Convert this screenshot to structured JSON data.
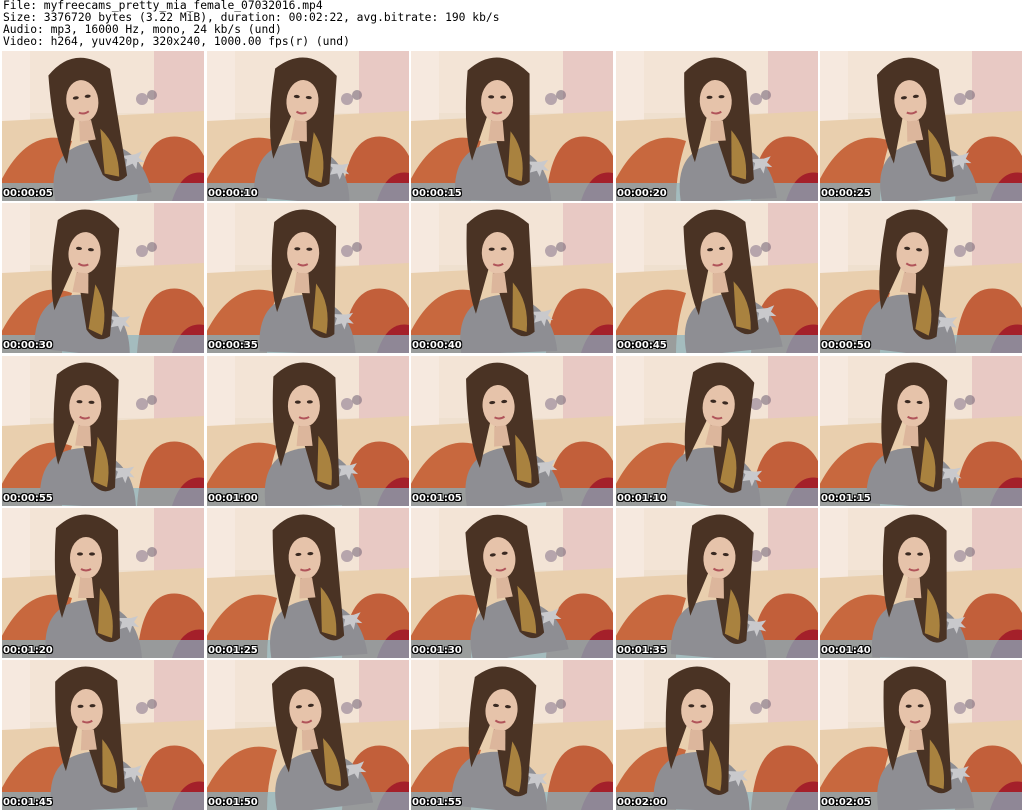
{
  "header": {
    "lines": [
      "File: myfreecams_pretty_mia_female_07032016.mp4",
      "Size: 3376720 bytes (3.22 MiB), duration: 00:02:22, avg.bitrate: 190 kb/s",
      "Audio: mp3, 16000 Hz, mono, 24 kb/s (und)",
      "Video: h264, yuv420p, 320x240, 1000.00 fps(r) (und)"
    ]
  },
  "thumbnails": {
    "timestamps": [
      "00:00:05",
      "00:00:10",
      "00:00:15",
      "00:00:20",
      "00:00:25",
      "00:00:30",
      "00:00:35",
      "00:00:40",
      "00:00:45",
      "00:00:50",
      "00:00:55",
      "00:01:00",
      "00:01:05",
      "00:01:10",
      "00:01:15",
      "00:01:20",
      "00:01:25",
      "00:01:30",
      "00:01:35",
      "00:01:40",
      "00:01:45",
      "00:01:50",
      "00:01:55",
      "00:02:00",
      "00:02:05"
    ]
  }
}
